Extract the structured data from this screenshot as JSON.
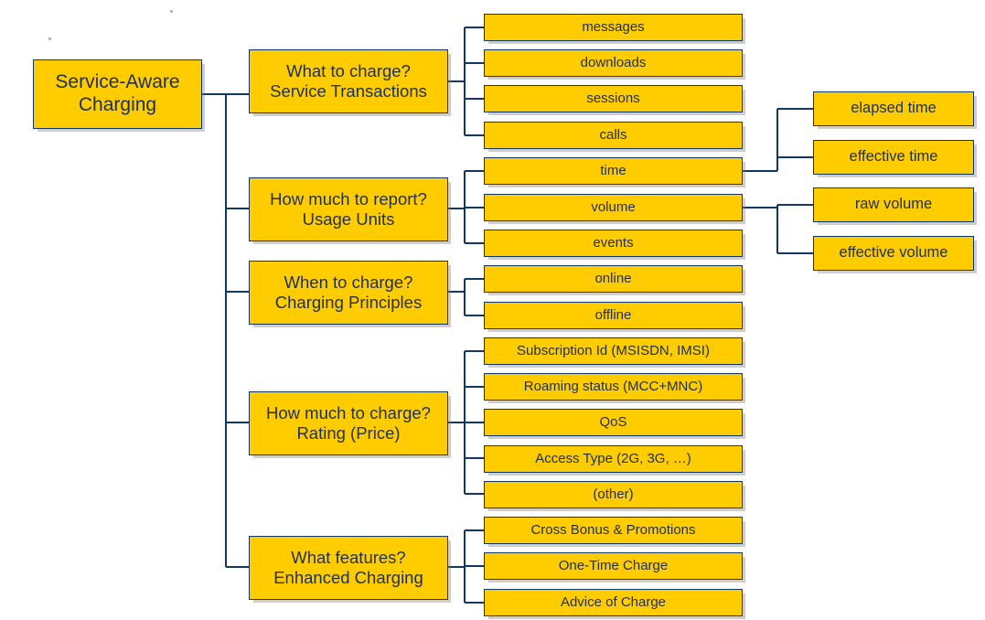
{
  "diagram": {
    "title": "Service-Aware Charging",
    "colors": {
      "node_fill": "#FFCC00",
      "node_border": "#123764",
      "text": "#1F3050",
      "connector": "#123764",
      "background": "#FFFFFF",
      "shadow": "#CFCBC2"
    },
    "root": {
      "label": "Service-Aware\nCharging"
    },
    "branches": [
      {
        "id": "service-transactions",
        "label": "What to charge?\nService Transactions",
        "question": "What to charge?",
        "category": "Service Transactions",
        "leaves": [
          {
            "id": "messages",
            "label": "messages"
          },
          {
            "id": "downloads",
            "label": "downloads"
          },
          {
            "id": "sessions",
            "label": "sessions"
          },
          {
            "id": "calls",
            "label": "calls"
          }
        ]
      },
      {
        "id": "usage-units",
        "label": "How much to report?\nUsage Units",
        "question": "How much to report?",
        "category": "Usage Units",
        "leaves": [
          {
            "id": "time",
            "label": "time",
            "subleaves": [
              {
                "id": "elapsed-time",
                "label": "elapsed time"
              },
              {
                "id": "effective-time",
                "label": "effective time"
              }
            ]
          },
          {
            "id": "volume",
            "label": "volume",
            "subleaves": [
              {
                "id": "raw-volume",
                "label": "raw volume"
              },
              {
                "id": "effective-volume",
                "label": "effective volume"
              }
            ]
          },
          {
            "id": "events",
            "label": "events"
          }
        ]
      },
      {
        "id": "charging-principles",
        "label": "When to charge?\nCharging Principles",
        "question": "When to charge?",
        "category": "Charging Principles",
        "leaves": [
          {
            "id": "online",
            "label": "online"
          },
          {
            "id": "offline",
            "label": "offline"
          }
        ]
      },
      {
        "id": "rating-price",
        "label": "How much to charge?\nRating (Price)",
        "question": "How much to charge?",
        "category": "Rating (Price)",
        "leaves": [
          {
            "id": "subscription-id",
            "label": "Subscription Id (MSISDN, IMSI)"
          },
          {
            "id": "roaming-status",
            "label": "Roaming status (MCC+MNC)"
          },
          {
            "id": "qos",
            "label": "QoS"
          },
          {
            "id": "access-type",
            "label": "Access Type (2G, 3G, …)"
          },
          {
            "id": "other",
            "label": "(other)"
          }
        ]
      },
      {
        "id": "enhanced-charging",
        "label": "What features?\nEnhanced Charging",
        "question": "What features?",
        "category": "Enhanced Charging",
        "leaves": [
          {
            "id": "cross-bonus",
            "label": "Cross Bonus & Promotions"
          },
          {
            "id": "one-time-charge",
            "label": "One-Time Charge"
          },
          {
            "id": "advice-of-charge",
            "label": "Advice of Charge"
          }
        ]
      }
    ]
  }
}
